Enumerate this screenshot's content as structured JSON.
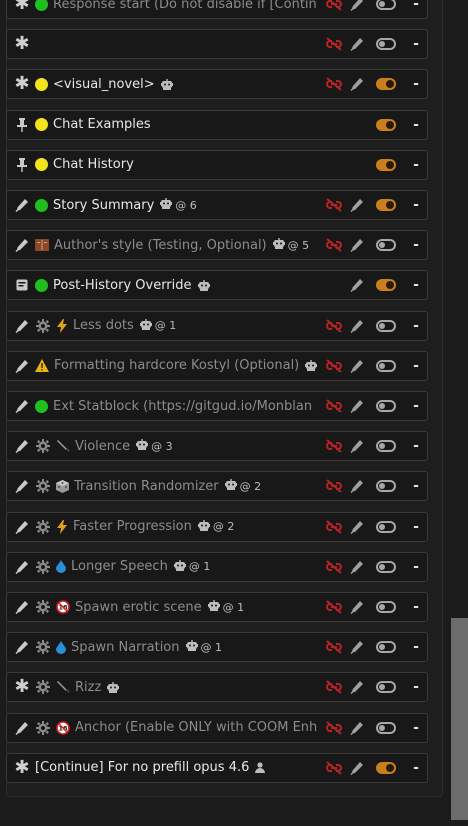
{
  "prompts": [
    {
      "lead": "asterisk",
      "lead2": "",
      "emoji": "green-dot",
      "name": "Response start (Do not disable if [Contin",
      "dim": true,
      "meta": "",
      "link": true,
      "edit": true,
      "toggle": "off"
    },
    {
      "lead": "asterisk",
      "lead2": "",
      "emoji": "",
      "name": "",
      "dim": false,
      "meta": "",
      "link": true,
      "edit": true,
      "toggle": "off"
    },
    {
      "lead": "asterisk",
      "lead2": "",
      "emoji": "yellow-dot",
      "name": "<visual_novel>",
      "dim": false,
      "meta": "bot",
      "link": true,
      "edit": true,
      "toggle": "on"
    },
    {
      "lead": "pin",
      "lead2": "",
      "emoji": "yellow-dot",
      "name": "Chat Examples",
      "dim": false,
      "meta": "",
      "link": false,
      "edit": false,
      "toggle": "on"
    },
    {
      "lead": "pin",
      "lead2": "",
      "emoji": "yellow-dot",
      "name": "Chat History",
      "dim": false,
      "meta": "",
      "link": false,
      "edit": false,
      "toggle": "on"
    },
    {
      "lead": "pen",
      "lead2": "",
      "emoji": "green-dot",
      "name": "Story Summary",
      "dim": false,
      "meta": "@ 6",
      "link": true,
      "edit": true,
      "toggle": "on"
    },
    {
      "lead": "pen",
      "lead2": "",
      "emoji": "book",
      "name": "Author's style (Testing, Optional)",
      "dim": true,
      "meta": "@ 5",
      "link": true,
      "edit": true,
      "toggle": "off"
    },
    {
      "lead": "note",
      "lead2": "",
      "emoji": "green-dot",
      "name": "Post-History Override",
      "dim": false,
      "meta": "bot",
      "link": false,
      "edit": true,
      "toggle": "on"
    },
    {
      "lead": "pen",
      "lead2": "gear",
      "emoji": "bolt",
      "name": "Less dots",
      "dim": true,
      "meta": "@ 1",
      "link": true,
      "edit": true,
      "toggle": "off"
    },
    {
      "lead": "pen",
      "lead2": "",
      "emoji": "warning",
      "name": "Formatting hardcore Kostyl (Optional)",
      "dim": true,
      "meta": "bot",
      "link": true,
      "edit": true,
      "toggle": "off"
    },
    {
      "lead": "pen",
      "lead2": "",
      "emoji": "green-dot",
      "name": "Ext Statblock (https://gitgud.io/Monblan",
      "dim": true,
      "meta": "",
      "link": true,
      "edit": true,
      "toggle": "off"
    },
    {
      "lead": "pen",
      "lead2": "gear",
      "emoji": "knife",
      "name": "Violence",
      "dim": true,
      "meta": "@ 3",
      "link": true,
      "edit": true,
      "toggle": "off"
    },
    {
      "lead": "pen",
      "lead2": "gear",
      "emoji": "dice",
      "name": "Transition Randomizer",
      "dim": true,
      "meta": "@ 2",
      "link": true,
      "edit": true,
      "toggle": "off"
    },
    {
      "lead": "pen",
      "lead2": "gear",
      "emoji": "bolt",
      "name": "Faster Progression",
      "dim": true,
      "meta": "@ 2",
      "link": true,
      "edit": true,
      "toggle": "off"
    },
    {
      "lead": "pen",
      "lead2": "gear",
      "emoji": "drop",
      "name": "Longer Speech",
      "dim": true,
      "meta": "@ 1",
      "link": true,
      "edit": true,
      "toggle": "off"
    },
    {
      "lead": "pen",
      "lead2": "gear",
      "emoji": "no18",
      "name": "Spawn erotic scene",
      "dim": true,
      "meta": "@ 1",
      "link": true,
      "edit": true,
      "toggle": "off"
    },
    {
      "lead": "pen",
      "lead2": "gear",
      "emoji": "drop",
      "name": "Spawn Narration",
      "dim": true,
      "meta": "@ 1",
      "link": true,
      "edit": true,
      "toggle": "off"
    },
    {
      "lead": "asterisk",
      "lead2": "gear",
      "emoji": "knife",
      "name": "Rizz",
      "dim": true,
      "meta": "bot",
      "link": true,
      "edit": true,
      "toggle": "off"
    },
    {
      "lead": "pen",
      "lead2": "gear",
      "emoji": "no18",
      "name": "Anchor (Enable ONLY with COOM Enh",
      "dim": true,
      "meta": "",
      "link": true,
      "edit": true,
      "toggle": "off"
    },
    {
      "lead": "asterisk",
      "lead2": "",
      "emoji": "",
      "name": "[Continue] For no prefill opus 4.6",
      "dim": false,
      "meta": "user",
      "link": true,
      "edit": true,
      "toggle": "on"
    }
  ],
  "remove_label": "-",
  "colors": {
    "toggle_on": "#c97f1e",
    "link_icon": "#b52323",
    "green_dot": "#1fbf1f",
    "yellow_dot": "#f2e31a"
  }
}
